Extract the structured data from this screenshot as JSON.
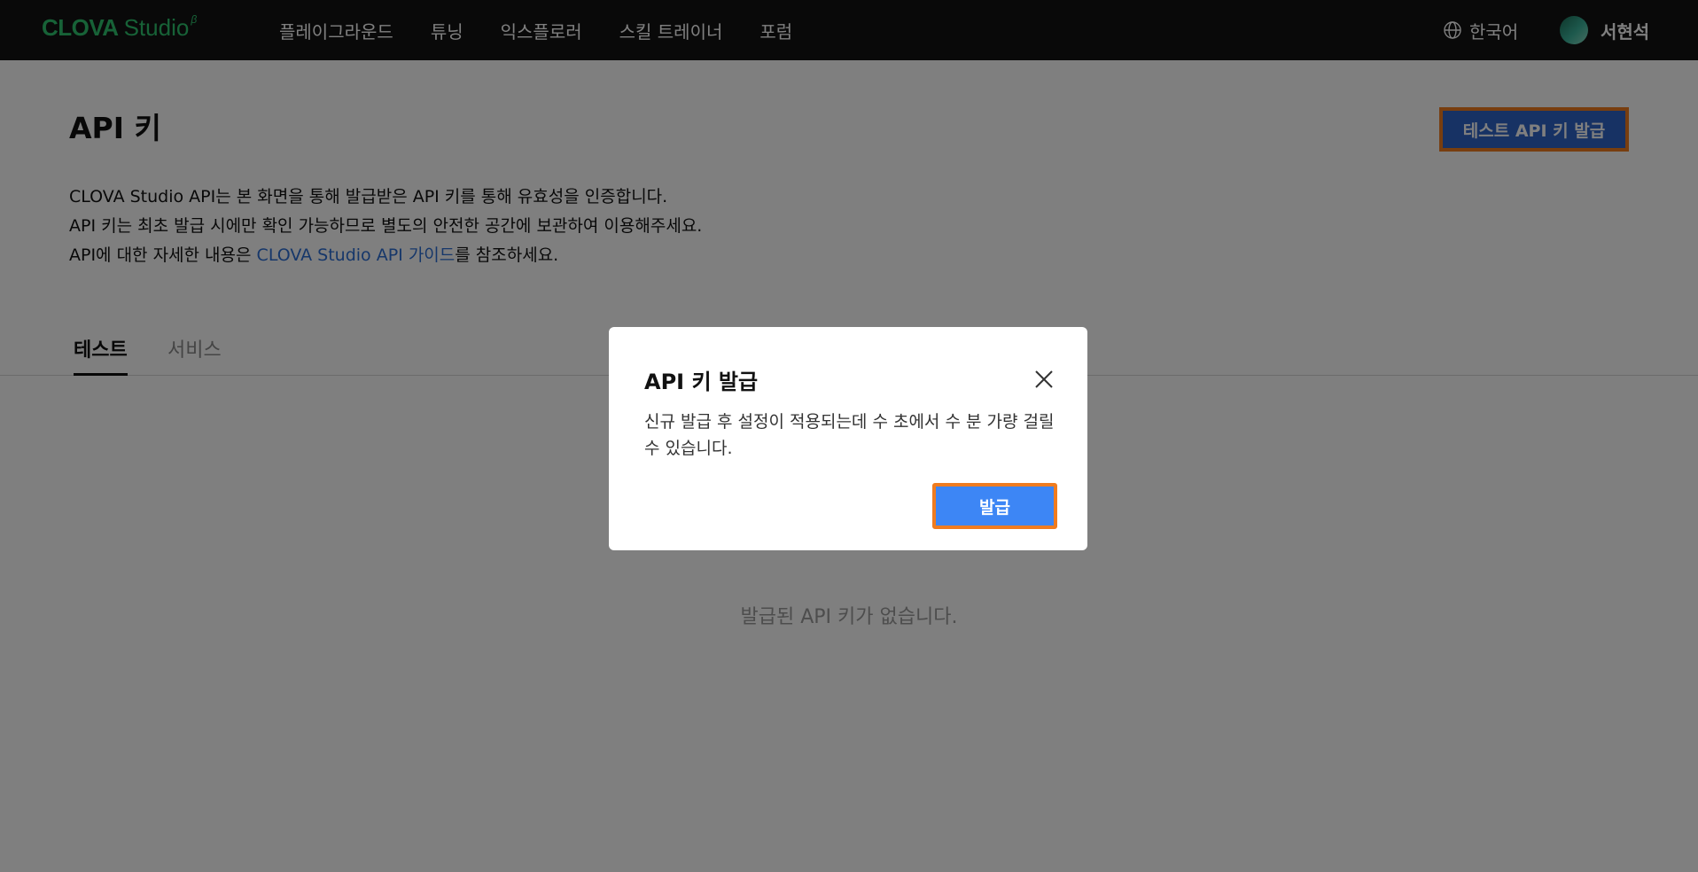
{
  "header": {
    "logo_main": "CLOVA",
    "logo_sub": "Studio",
    "logo_beta": "β",
    "nav": [
      "플레이그라운드",
      "튜닝",
      "익스플로러",
      "스킬 트레이너",
      "포럼"
    ],
    "language": "한국어",
    "user_name": "서현석"
  },
  "page": {
    "title": "API 키",
    "issue_test_button": "테스트 API 키 발급",
    "desc_line1": "CLOVA Studio API는 본 화면을 통해 발급받은 API 키를 통해 유효성을 인증합니다.",
    "desc_line2": "API 키는 최초 발급 시에만 확인 가능하므로 별도의 안전한 공간에 보관하여 이용해주세요.",
    "desc_line3_prefix": "API에 대한 자세한 내용은 ",
    "desc_line3_link": "CLOVA Studio API 가이드",
    "desc_line3_suffix": "를 참조하세요.",
    "tabs": [
      "테스트",
      "서비스"
    ],
    "empty_message": "발급된 API 키가 없습니다."
  },
  "modal": {
    "title": "API 키 발급",
    "body": "신규 발급 후 설정이 적용되는데 수 초에서 수 분 가량 걸릴 수 있습니다.",
    "confirm_label": "발급"
  },
  "icons": {
    "globe": "globe-icon",
    "close": "close-icon"
  },
  "colors": {
    "brand_green": "#2fc46f",
    "primary_blue": "#3d86f5",
    "highlight_orange": "#f07c1f",
    "link_blue": "#2c6ed5"
  }
}
